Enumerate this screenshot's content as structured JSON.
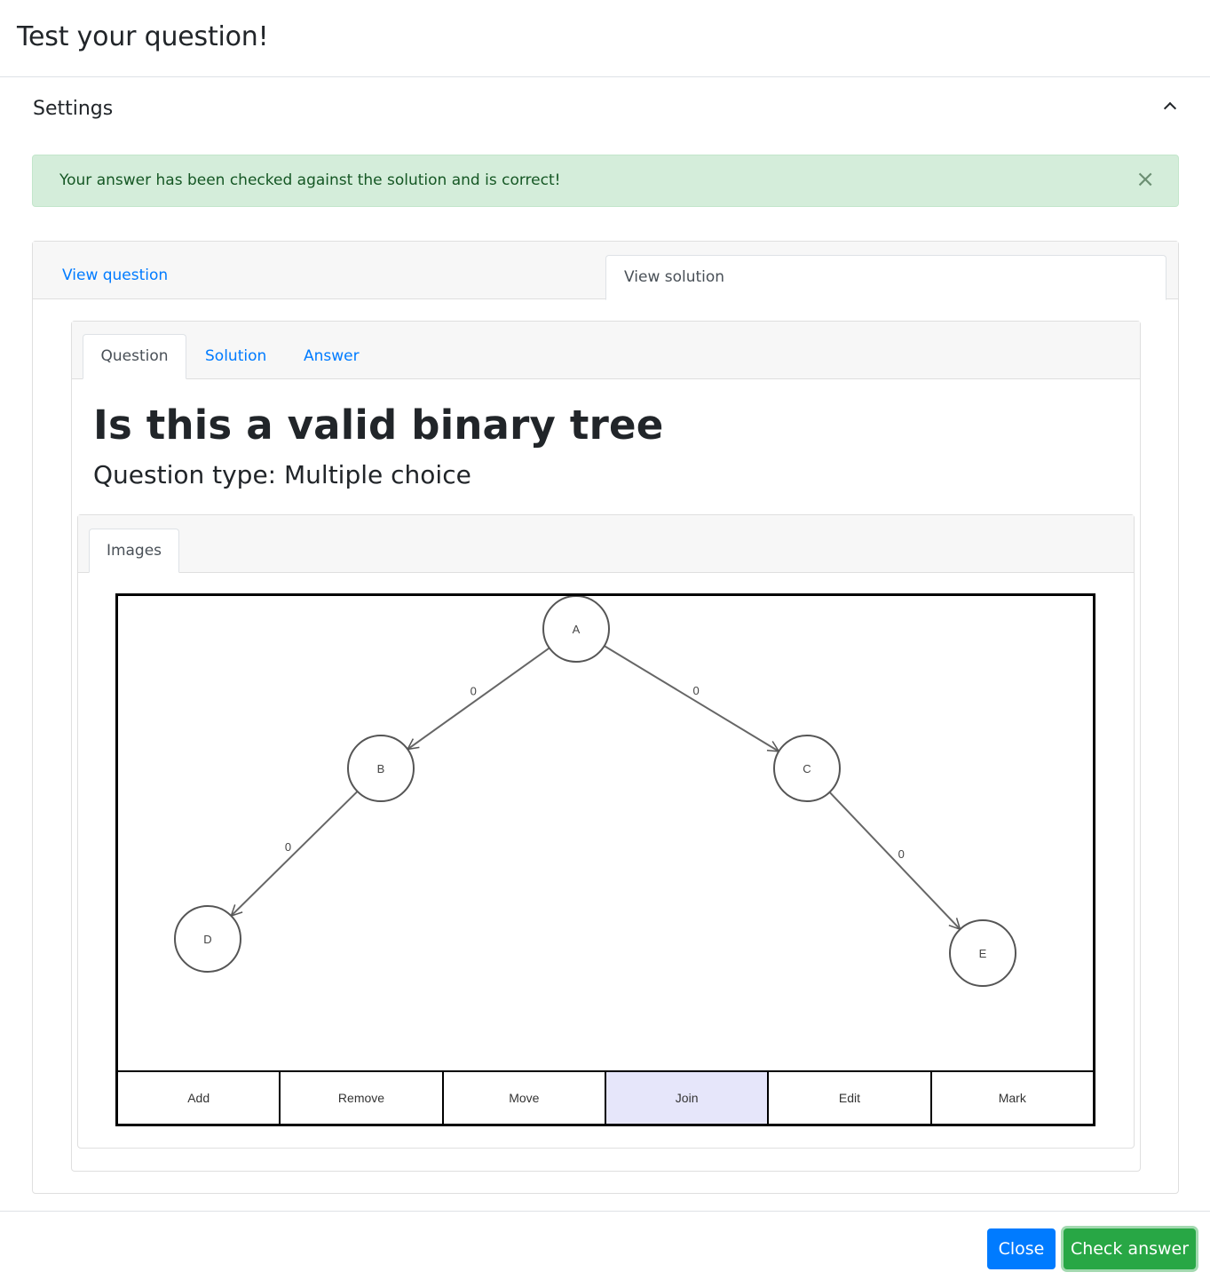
{
  "modal": {
    "title": "Test your question!"
  },
  "settings": {
    "title": "Settings",
    "toggle_icon": "chevron-up-icon"
  },
  "alert": {
    "message": "Your answer has been checked against the solution and is correct!",
    "close_glyph": "×",
    "color": "#155724",
    "background": "#d4edda"
  },
  "outer_tabs": [
    {
      "label": "View question",
      "active": false
    },
    {
      "label": "View solution",
      "active": true
    }
  ],
  "inner_tabs": [
    {
      "label": "Question",
      "active": true
    },
    {
      "label": "Solution",
      "active": false
    },
    {
      "label": "Answer",
      "active": false
    }
  ],
  "question": {
    "title": "Is this a valid binary tree",
    "type_text": "Question type: Multiple choice"
  },
  "images_tab": {
    "label": "Images"
  },
  "tree": {
    "nodes": [
      {
        "id": "A",
        "label": "A"
      },
      {
        "id": "B",
        "label": "B"
      },
      {
        "id": "C",
        "label": "C"
      },
      {
        "id": "D",
        "label": "D"
      },
      {
        "id": "E",
        "label": "E"
      }
    ],
    "edges": [
      {
        "from": "A",
        "to": "B",
        "weight": "0"
      },
      {
        "from": "A",
        "to": "C",
        "weight": "0"
      },
      {
        "from": "B",
        "to": "D",
        "weight": "0"
      },
      {
        "from": "C",
        "to": "E",
        "weight": "0"
      }
    ]
  },
  "toolbar": {
    "buttons": [
      {
        "label": "Add",
        "active": false
      },
      {
        "label": "Remove",
        "active": false
      },
      {
        "label": "Move",
        "active": false
      },
      {
        "label": "Join",
        "active": true
      },
      {
        "label": "Edit",
        "active": false
      },
      {
        "label": "Mark",
        "active": false
      }
    ],
    "active_color": "#e6e6fa"
  },
  "footer": {
    "close_label": "Close",
    "check_label": "Check answer",
    "close_color": "#007bff",
    "check_color": "#28a745"
  }
}
